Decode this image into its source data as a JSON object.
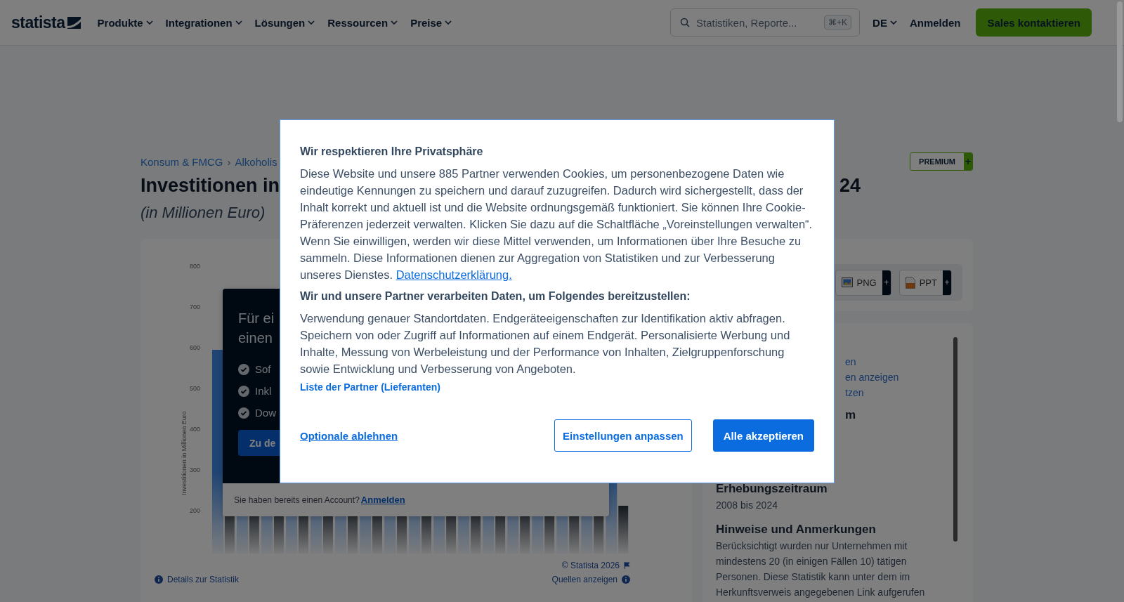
{
  "header": {
    "logo": "statista",
    "nav": [
      {
        "label": "Produkte"
      },
      {
        "label": "Integrationen"
      },
      {
        "label": "Lösungen"
      },
      {
        "label": "Ressourcen"
      },
      {
        "label": "Preise"
      }
    ],
    "search": {
      "placeholder": "Statistiken, Reporte...",
      "shortcut": "⌘+K"
    },
    "language": "DE",
    "login": "Anmelden",
    "cta": "Sales kontaktieren"
  },
  "breadcrumb": {
    "items": [
      "Konsum & FMCG",
      "Alkoholis"
    ],
    "separator": "›"
  },
  "premium_badge": {
    "label": "PREMIUM",
    "plus": "+"
  },
  "title_start": "Investitionen in",
  "title_end": "24",
  "subtitle": "(in Millionen Euro)",
  "chart": {
    "y_axis_label": "Investitionen in Millionen Euro",
    "y_ticks": [
      "800",
      "700",
      "600",
      "500",
      "400",
      "300",
      "200"
    ],
    "copyright": "© Statista 2026",
    "sources_link": "Quellen anzeigen",
    "details_link": "Details zur Statistik"
  },
  "paywall": {
    "heading_lines": [
      "Für ei",
      "einen"
    ],
    "features": [
      "Sof",
      "Inkl",
      "Dow"
    ],
    "button": "Zu de",
    "account_text": "Sie haben bereits einen Account?",
    "login_link": "Anmelden"
  },
  "downloads": [
    {
      "label": "PNG",
      "kind": "image",
      "plus": "+"
    },
    {
      "label": "PPT",
      "kind": "slides",
      "plus": "+"
    }
  ],
  "info": {
    "fragments": [
      {
        "text": "en",
        "kind": "link"
      },
      {
        "text": "en anzeigen",
        "kind": "link"
      },
      {
        "text": "tzen",
        "kind": "link"
      },
      {
        "text": "m",
        "kind": "heading"
      }
    ],
    "sections": [
      {
        "heading": "Erhebungszeitraum",
        "text": "2008 bis 2024"
      },
      {
        "heading": "Hinweise und Anmerkungen",
        "text": "Berücksichtigt wurden nur Unternehmen mit mindestens 20 (in einigen Fällen 10) tätigen Personen. Diese Statistik kann unter dem im Herkunftsverweis angegebenen Link aufgerufen"
      }
    ]
  },
  "consent": {
    "title": "Wir respektieren Ihre Privatsphäre",
    "paragraph": "Diese Website und unsere 885 Partner verwenden Cookies, um personenbezogene Daten wie eindeutige Kennungen zu speichern und darauf zuzugreifen. Dadurch wird sichergestellt, dass der Inhalt korrekt und aktuell ist und die Website ordnungsgemäß funktioniert. Sie können Ihre Cookie-Präferenzen jederzeit verwalten. Klicken Sie dazu auf die Schaltfläche „Voreinstellungen verwalten“. Wenn Sie einwilligen, werden wir diese Mittel verwenden, um Informationen über Ihre Besuche zu sammeln. Diese Informationen dienen zur Aggregation von Statistiken und zur Verbesserung unseres Dienstes.",
    "privacy_link": "Datenschutzerklärung.",
    "purposes_title": "Wir und unsere Partner verarbeiten Daten, um Folgendes bereitzustellen:",
    "purposes_text": "Verwendung genauer Standortdaten. Endgeräteeigenschaften zur Identifikation aktiv abfragen. Speichern von oder Zugriff auf Informationen auf einem Endgerät. Personalisierte Werbung und Inhalte, Messung von Werbeleistung und der Performance von Inhalten, Zielgruppenforschung sowie Entwicklung und Verbesserung von Angeboten.",
    "partners_link": "Liste der Partner (Lieferanten)",
    "reject": "Optionale ablehnen",
    "customize": "Einstellungen anpassen",
    "accept": "Alle akzeptieren"
  }
}
